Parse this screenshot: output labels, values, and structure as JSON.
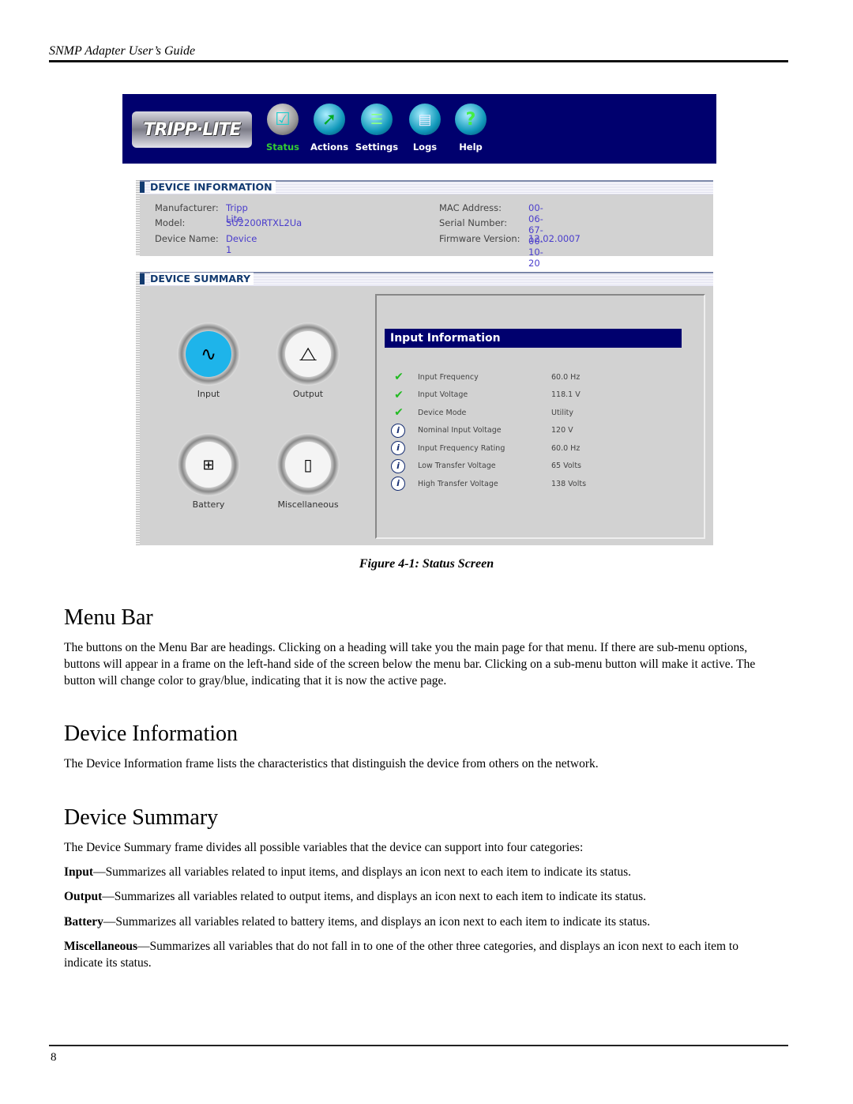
{
  "page": {
    "header": "SNMP Adapter User’s Guide",
    "page_number": "8",
    "figure_caption": "Figure 4-1: Status Screen"
  },
  "screen": {
    "logo": "TRIPP·LITE",
    "menu": [
      {
        "label": "Status",
        "icon": "checkmark-icon",
        "active": true
      },
      {
        "label": "Actions",
        "icon": "actions-arrow-icon",
        "active": false
      },
      {
        "label": "Settings",
        "icon": "sliders-icon",
        "active": false
      },
      {
        "label": "Logs",
        "icon": "log-document-icon",
        "active": false
      },
      {
        "label": "Help",
        "icon": "question-mark-icon",
        "active": false
      }
    ],
    "device_information": {
      "title": "DEVICE INFORMATION",
      "left": [
        {
          "label": "Manufacturer:",
          "value": "Tripp Lite"
        },
        {
          "label": "Model:",
          "value": "SU2200RTXL2Ua"
        },
        {
          "label": "Device Name:",
          "value": "Device 1"
        }
      ],
      "right": [
        {
          "label": "MAC Address:",
          "value": "00-06-67-00-10-20"
        },
        {
          "label": "Serial Number:",
          "value": ""
        },
        {
          "label": "Firmware Version:",
          "value": "12.02.0007"
        }
      ]
    },
    "device_summary": {
      "title": "DEVICE SUMMARY",
      "categories": [
        {
          "label": "Input",
          "icon": "sine-wave-icon",
          "selected": true
        },
        {
          "label": "Output",
          "icon": "output-lever-icon",
          "selected": false
        },
        {
          "label": "Battery",
          "icon": "battery-icon",
          "selected": false
        },
        {
          "label": "Miscellaneous",
          "icon": "device-tower-icon",
          "selected": false
        }
      ],
      "panel": {
        "title": "Input Information",
        "rows": [
          {
            "status": "ok",
            "name": "Input Frequency",
            "value": "60.0 Hz"
          },
          {
            "status": "ok",
            "name": "Input Voltage",
            "value": "118.1 V"
          },
          {
            "status": "ok",
            "name": "Device Mode",
            "value": "Utility"
          },
          {
            "status": "info",
            "name": "Nominal Input Voltage",
            "value": "120 V"
          },
          {
            "status": "info",
            "name": "Input Frequency Rating",
            "value": "60.0 Hz"
          },
          {
            "status": "info",
            "name": "Low Transfer Voltage",
            "value": "65 Volts"
          },
          {
            "status": "info",
            "name": "High Transfer Voltage",
            "value": "138 Volts"
          }
        ]
      }
    }
  },
  "sections": {
    "menu_bar": {
      "heading": "Menu Bar",
      "body": "The  buttons on the Menu Bar are headings. Clicking on a heading will take you the main page for that menu. If there are sub-menu options, buttons will appear in a frame on the left-hand side of the screen below the menu bar. Clicking on a sub-menu button will make it active. The button will change color to gray/blue, indicating that it is now the active page."
    },
    "device_information": {
      "heading": "Device Information",
      "body": "The Device Information frame lists the characteristics that distinguish the device from others on the network."
    },
    "device_summary": {
      "heading": "Device Summary",
      "intro": "The Device Summary frame divides all possible variables that the device can support into four categories:",
      "items": [
        {
          "term": "Input",
          "desc": "—Summarizes all variables related to input items, and displays an icon next to each item to indicate its status."
        },
        {
          "term": "Output",
          "desc": "—Summarizes all variables related to output items, and displays an icon next to each item to indicate its status."
        },
        {
          "term": "Battery",
          "desc": "—Summarizes all variables related to battery items, and displays an icon next to each item to indicate its status."
        },
        {
          "term": "Miscellaneous",
          "desc": "—Summarizes all variables that do not fall in to one of the other three categories, and displays an icon next to each item to indicate its status."
        }
      ]
    }
  }
}
